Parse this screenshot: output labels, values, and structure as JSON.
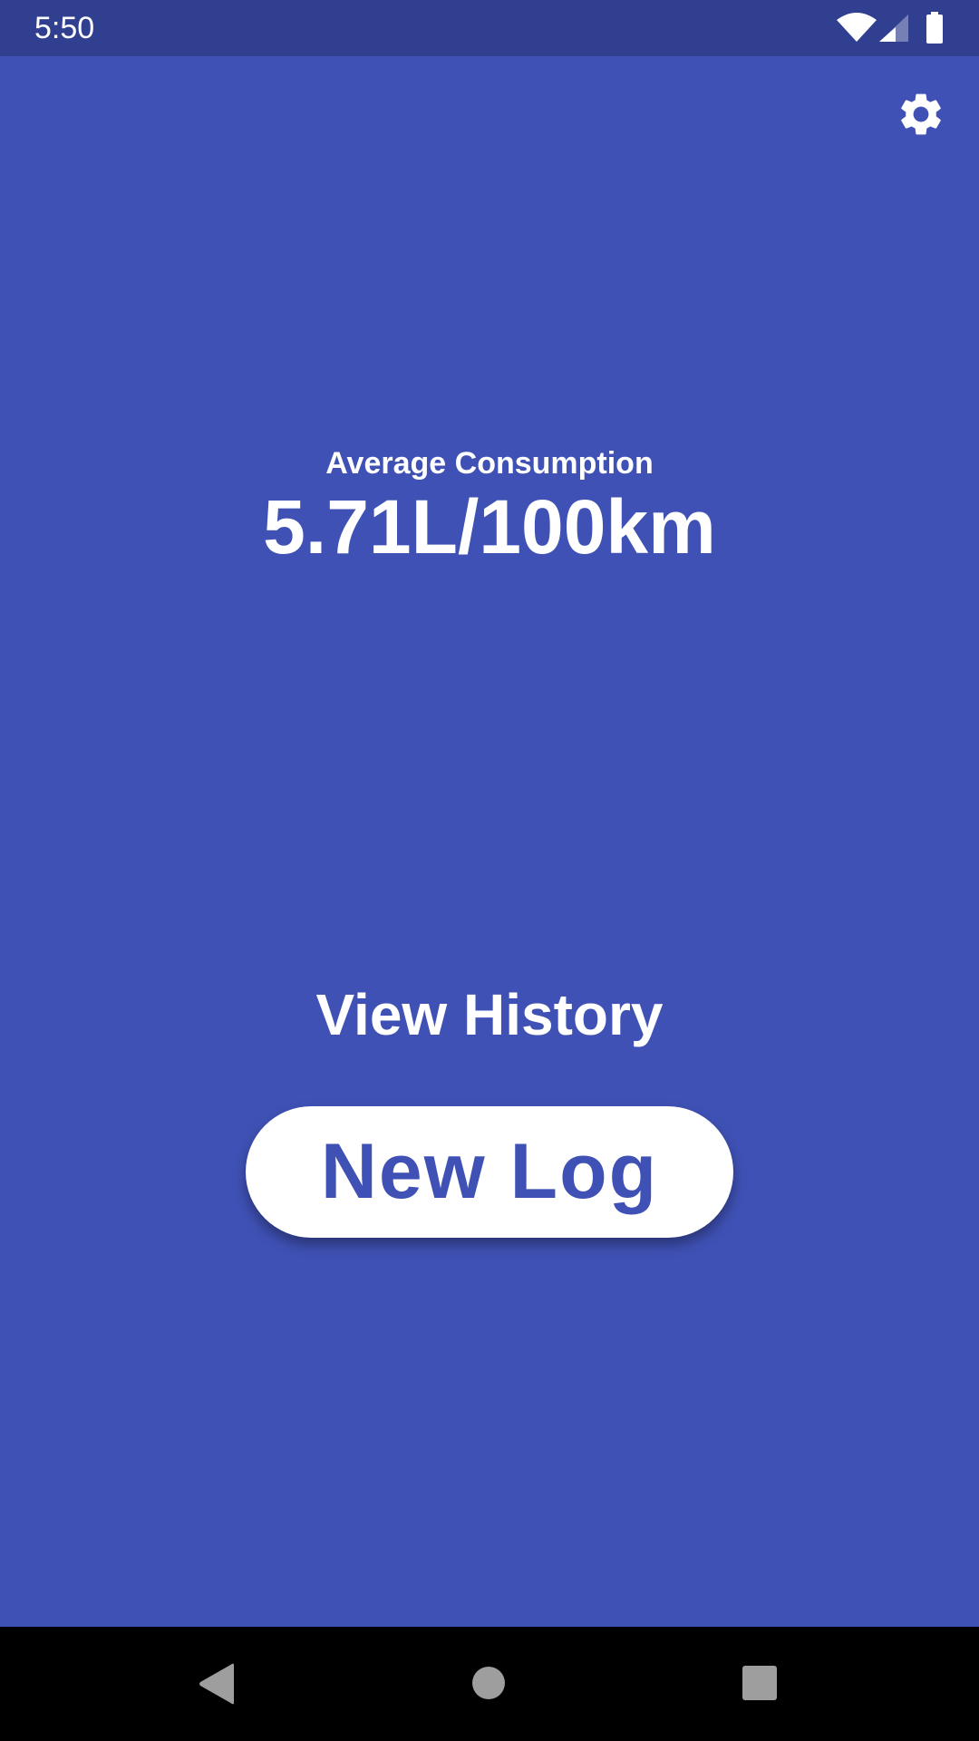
{
  "status_bar": {
    "time": "5:50",
    "icons": [
      "wifi-icon",
      "cell-signal-icon",
      "battery-icon"
    ]
  },
  "toolbar": {
    "settings_icon": "gear-icon"
  },
  "main": {
    "label": "Average Consumption",
    "value": "5.71L/100km",
    "view_history_label": "View History",
    "new_log_label": "New Log"
  },
  "colors": {
    "primary": "#3F51B5",
    "status_bar": "#303F8F"
  },
  "nav_bar": {
    "icons": [
      "back-icon",
      "home-icon",
      "recents-icon"
    ]
  }
}
